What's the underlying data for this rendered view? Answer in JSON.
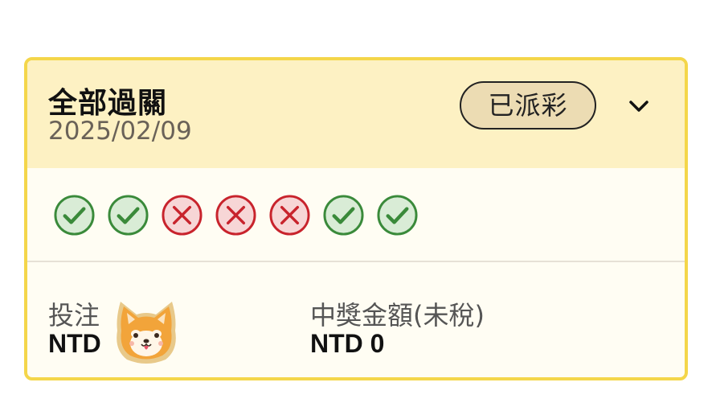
{
  "card": {
    "title": "全部過關",
    "date": "2025/02/09",
    "status": "已派彩",
    "expand_icon": "chevron-down-icon",
    "results": [
      {
        "outcome": "win",
        "icon": "check-circle-icon"
      },
      {
        "outcome": "win",
        "icon": "check-circle-icon"
      },
      {
        "outcome": "lose",
        "icon": "x-circle-icon"
      },
      {
        "outcome": "lose",
        "icon": "x-circle-icon"
      },
      {
        "outcome": "lose",
        "icon": "x-circle-icon"
      },
      {
        "outcome": "win",
        "icon": "check-circle-icon"
      },
      {
        "outcome": "win",
        "icon": "check-circle-icon"
      }
    ],
    "stake": {
      "label": "投注",
      "value": "NTD"
    },
    "payout": {
      "label": "中獎金額(未稅)",
      "value": "NTD 0"
    },
    "mascot": "shiba-dog-mascot-icon"
  },
  "colors": {
    "border": "#f4d64a",
    "header_bg": "#fdf1c3",
    "win_green": "#3a8a3a",
    "lose_red": "#c8232c",
    "badge_bg": "#ecdcb3"
  }
}
